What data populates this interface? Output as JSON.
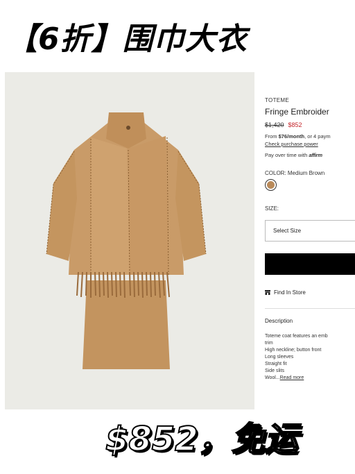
{
  "banner_top": "【6折】围巾大衣",
  "banner_bottom": "$852，免运",
  "product": {
    "brand": "TOTEME",
    "name": "Fringe Embroider",
    "original_price": "$1,420",
    "sale_price": "$852",
    "finance_prefix": "From ",
    "finance_amount": "$76/month",
    "finance_suffix": ", or 4 paym",
    "check_link": "Check purchase power",
    "pay_over": "Pay over time with ",
    "affirm": "affirm",
    "color_label": "COLOR: Medium Brown",
    "swatch_color": "#b98a5a",
    "size_label": "SIZE:",
    "size_select": "Select Size",
    "find_in_store": "Find In Store",
    "description_title": "Description",
    "description_lines": [
      "Toteme coat features an emb",
      "trim",
      "High neckline; button front",
      "Long sleeves",
      "Straight fit",
      "Side slits"
    ],
    "description_last_prefix": "Wool...",
    "read_more": "Read more"
  },
  "colors": {
    "photo_bg": "#ebebe6",
    "coat": "#c89a68",
    "sale_red": "#c4252b"
  }
}
